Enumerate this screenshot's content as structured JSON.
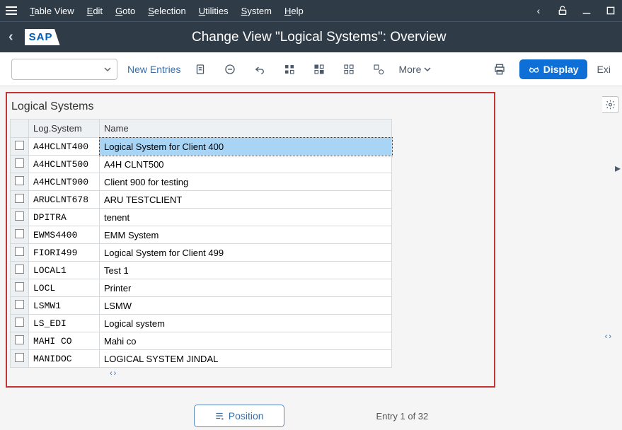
{
  "menu": {
    "items": [
      "Table View",
      "Edit",
      "Goto",
      "Selection",
      "Utilities",
      "System",
      "Help"
    ]
  },
  "titlebar": {
    "logo": "SAP",
    "title": "Change View \"Logical Systems\": Overview"
  },
  "toolbar": {
    "new_entries": "New Entries",
    "more": "More",
    "display": "Display",
    "exit": "Exi"
  },
  "panel": {
    "title": "Logical Systems",
    "columns": {
      "sys": "Log.System",
      "name": "Name"
    },
    "rows": [
      {
        "sys": "A4HCLNT400",
        "name": "Logical System for Client 400",
        "selected": true
      },
      {
        "sys": "A4HCLNT500",
        "name": "A4H CLNT500",
        "selected": false
      },
      {
        "sys": "A4HCLNT900",
        "name": "Client 900 for testing",
        "selected": false
      },
      {
        "sys": "ARUCLNT678",
        "name": "ARU TESTCLIENT",
        "selected": false
      },
      {
        "sys": "DPITRA",
        "name": "tenent",
        "selected": false
      },
      {
        "sys": "EWMS4400",
        "name": "EMM System",
        "selected": false
      },
      {
        "sys": "FIORI499",
        "name": "Logical System for Client 499",
        "selected": false
      },
      {
        "sys": "LOCAL1",
        "name": "Test 1",
        "selected": false
      },
      {
        "sys": "LOCL",
        "name": "Printer",
        "selected": false
      },
      {
        "sys": "LSMW1",
        "name": "LSMW",
        "selected": false
      },
      {
        "sys": "LS_EDI",
        "name": "Logical system",
        "selected": false
      },
      {
        "sys": "MAHI CO",
        "name": "Mahi co",
        "selected": false
      },
      {
        "sys": "MANIDOC",
        "name": "LOGICAL SYSTEM JINDAL",
        "selected": false
      }
    ]
  },
  "footer": {
    "position": "Position",
    "entry": "Entry 1 of 32"
  }
}
